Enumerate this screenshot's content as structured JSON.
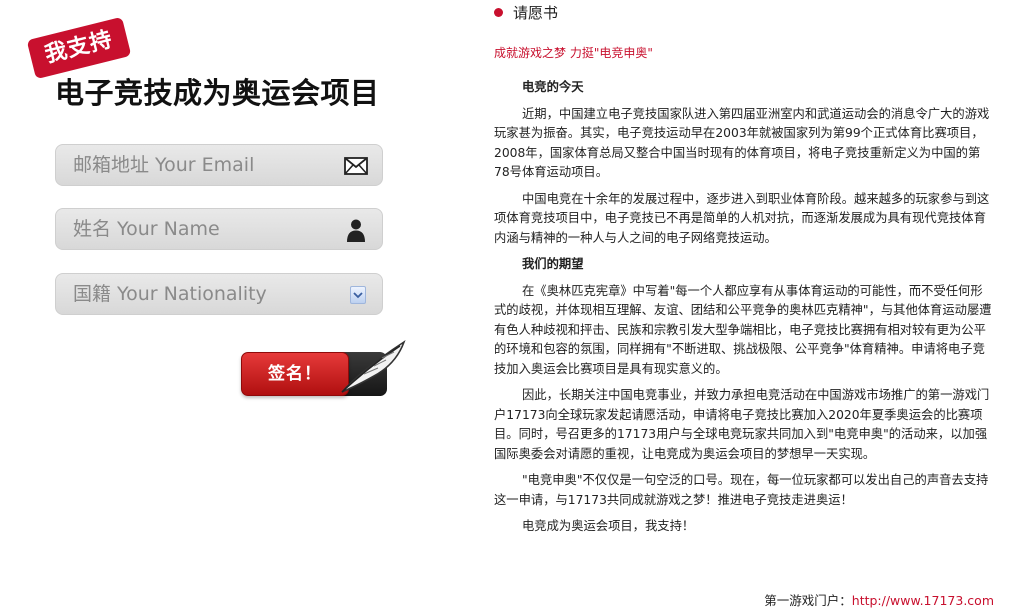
{
  "stamp": {
    "text": "我支持"
  },
  "title": "电子竞技成为奥运会项目",
  "form": {
    "email_placeholder": "邮箱地址 Your Email",
    "name_placeholder": "姓名 Your Name",
    "nationality_placeholder": "国籍 Your Nationality",
    "sign_button": "签名！"
  },
  "petition": {
    "header": "请愿书",
    "slogan": "成就游戏之梦 力挺\"电竞申奥\"",
    "section1_title": "电竞的今天",
    "p1": "近期，中国建立电子竞技国家队进入第四届亚洲室内和武道运动会的消息令广大的游戏玩家甚为振奋。其实，电子竞技运动早在2003年就被国家列为第99个正式体育比赛项目，2008年，国家体育总局又整合中国当时现有的体育项目，将电子竞技重新定义为中国的第78号体育运动项目。",
    "p2": "中国电竞在十余年的发展过程中，逐步进入到职业体育阶段。越来越多的玩家参与到这项体育竞技项目中，电子竞技已不再是简单的人机对抗，而逐渐发展成为具有现代竞技体育内涵与精神的一种人与人之间的电子网络竞技运动。",
    "section2_title": "我们的期望",
    "p3": "在《奥林匹克宪章》中写着\"每一个人都应享有从事体育运动的可能性，而不受任何形式的歧视，并体现相互理解、友谊、团结和公平竞争的奥林匹克精神\"，与其他体育运动屡遭有色人种歧视和抨击、民族和宗教引发大型争端相比，电子竞技比赛拥有相对较有更为公平的环境和包容的氛围，同样拥有\"不断进取、挑战极限、公平竞争\"体育精神。申请将电子竞技加入奥运会比赛项目是具有现实意义的。",
    "p4": "因此，长期关注中国电竞事业，并致力承担电竞活动在中国游戏市场推广的第一游戏门户17173向全球玩家发起请愿活动，申请将电子竞技比赛加入2020年夏季奥运会的比赛项目。同时，号召更多的17173用户与全球电竞玩家共同加入到\"电竞申奥\"的活动来，以加强国际奥委会对请愿的重视，让电竞成为奥运会项目的梦想早一天实现。",
    "p5": "\"电竞申奥\"不仅仅是一句空泛的口号。现在，每一位玩家都可以发出自己的声音去支持这一申请，与17173共同成就游戏之梦！推进电子竞技走进奥运！",
    "closing": "电竞成为奥运会项目，我支持！"
  },
  "footer": {
    "label": "第一游戏门户：",
    "url": "http://www.17173.com"
  },
  "colors": {
    "accent": "#c8102e",
    "button_red": "#d42020",
    "field_bg": "#e2e2e2"
  },
  "icons": [
    "envelope-icon",
    "person-icon",
    "dropdown-arrow-icon",
    "quill-feather-icon",
    "red-dot-bullet"
  ]
}
